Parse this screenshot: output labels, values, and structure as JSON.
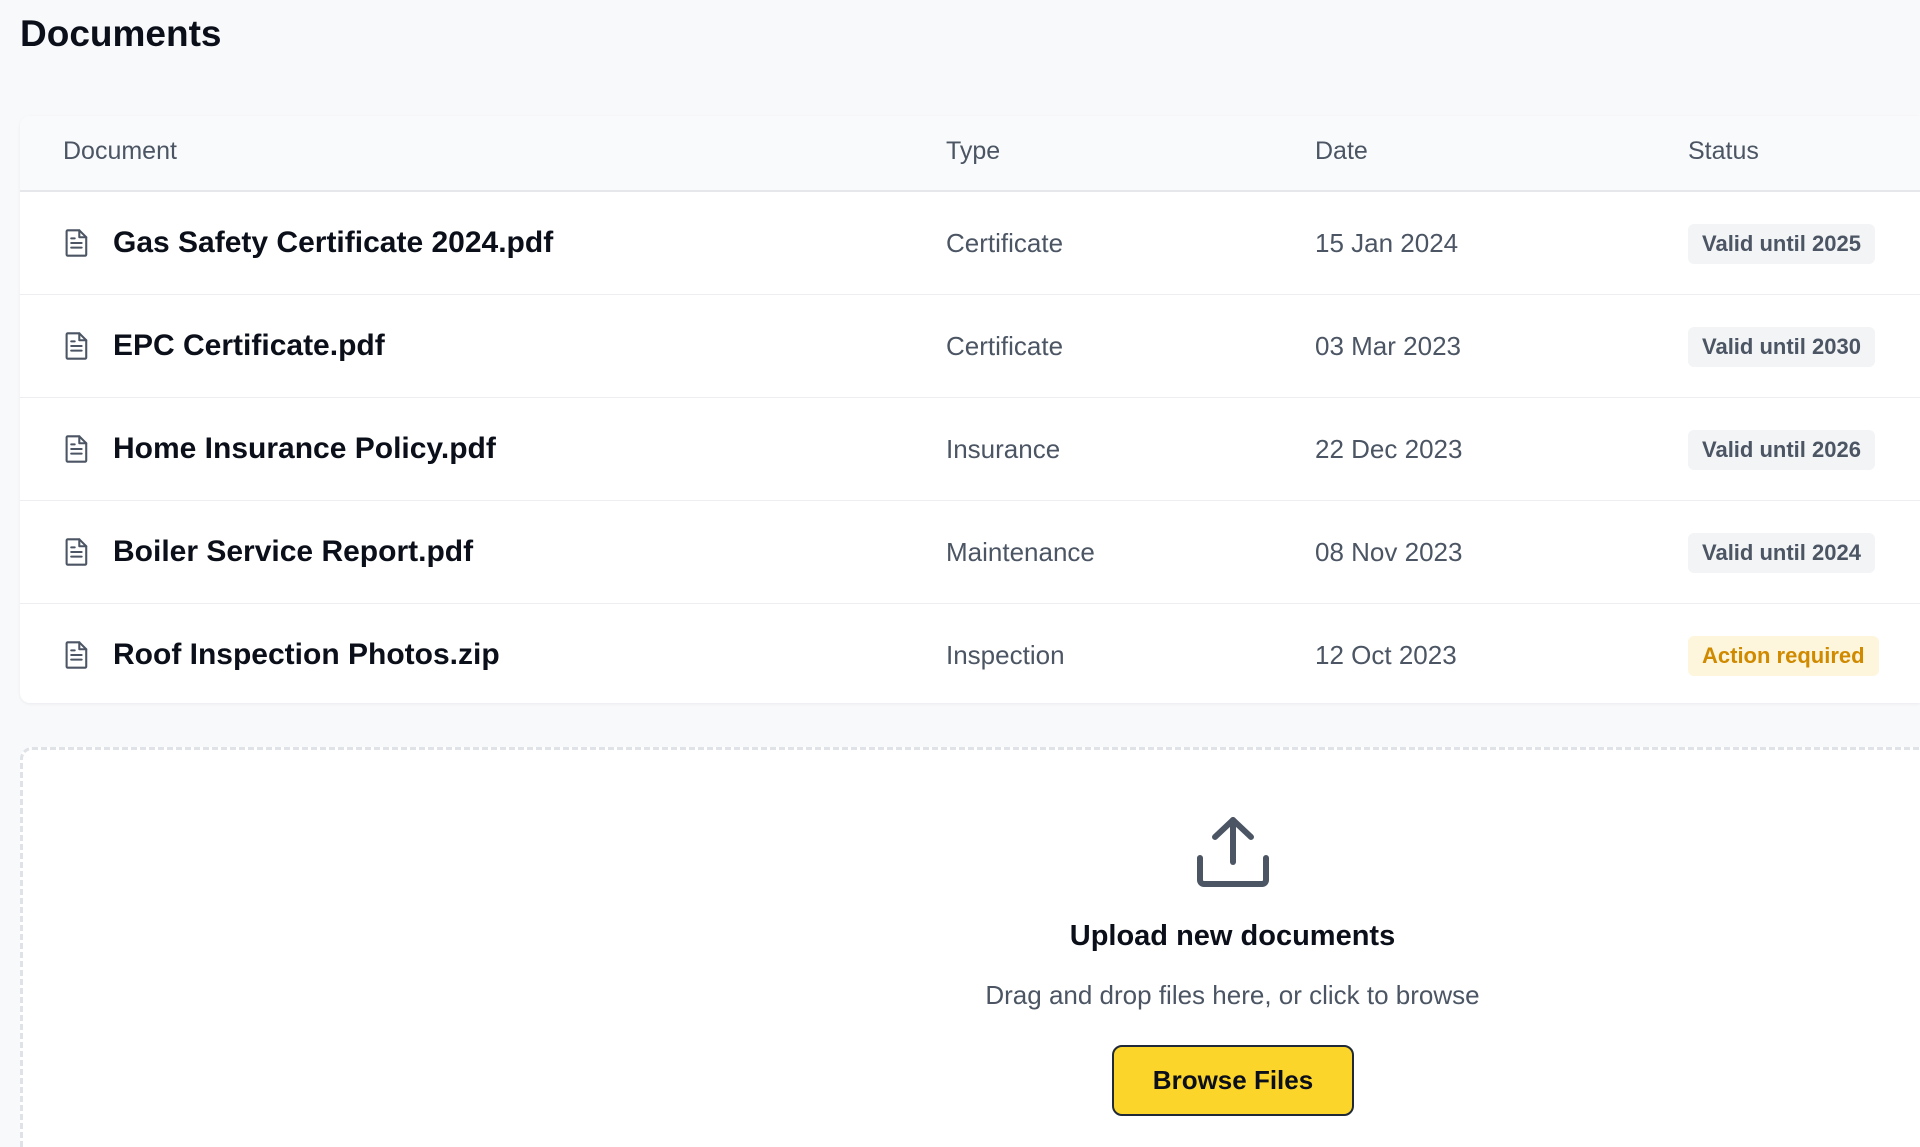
{
  "page": {
    "title": "Documents"
  },
  "table": {
    "headers": {
      "document": "Document",
      "type": "Type",
      "date": "Date",
      "status": "Status"
    },
    "rows": [
      {
        "name": "Gas Safety Certificate 2024.pdf",
        "type": "Certificate",
        "date": "15 Jan 2024",
        "status": "Valid until 2025",
        "status_kind": "neutral",
        "icon": "file-icon"
      },
      {
        "name": "EPC Certificate.pdf",
        "type": "Certificate",
        "date": "03 Mar 2023",
        "status": "Valid until 2030",
        "status_kind": "neutral",
        "icon": "file-icon"
      },
      {
        "name": "Home Insurance Policy.pdf",
        "type": "Insurance",
        "date": "22 Dec 2023",
        "status": "Valid until 2026",
        "status_kind": "neutral",
        "icon": "file-icon"
      },
      {
        "name": "Boiler Service Report.pdf",
        "type": "Maintenance",
        "date": "08 Nov 2023",
        "status": "Valid until 2024",
        "status_kind": "neutral",
        "icon": "file-icon"
      },
      {
        "name": "Roof Inspection Photos.zip",
        "type": "Inspection",
        "date": "12 Oct 2023",
        "status": "Action required",
        "status_kind": "warning",
        "icon": "file-icon"
      }
    ]
  },
  "upload": {
    "icon": "upload-icon",
    "title": "Upload new documents",
    "hint": "Drag and drop files here, or click to browse",
    "button_label": "Browse Files"
  },
  "colors": {
    "accent": "#fcd52b",
    "warning_text": "#d08a00",
    "warning_bg": "#fef6dc",
    "badge_bg": "#f3f4f6"
  }
}
